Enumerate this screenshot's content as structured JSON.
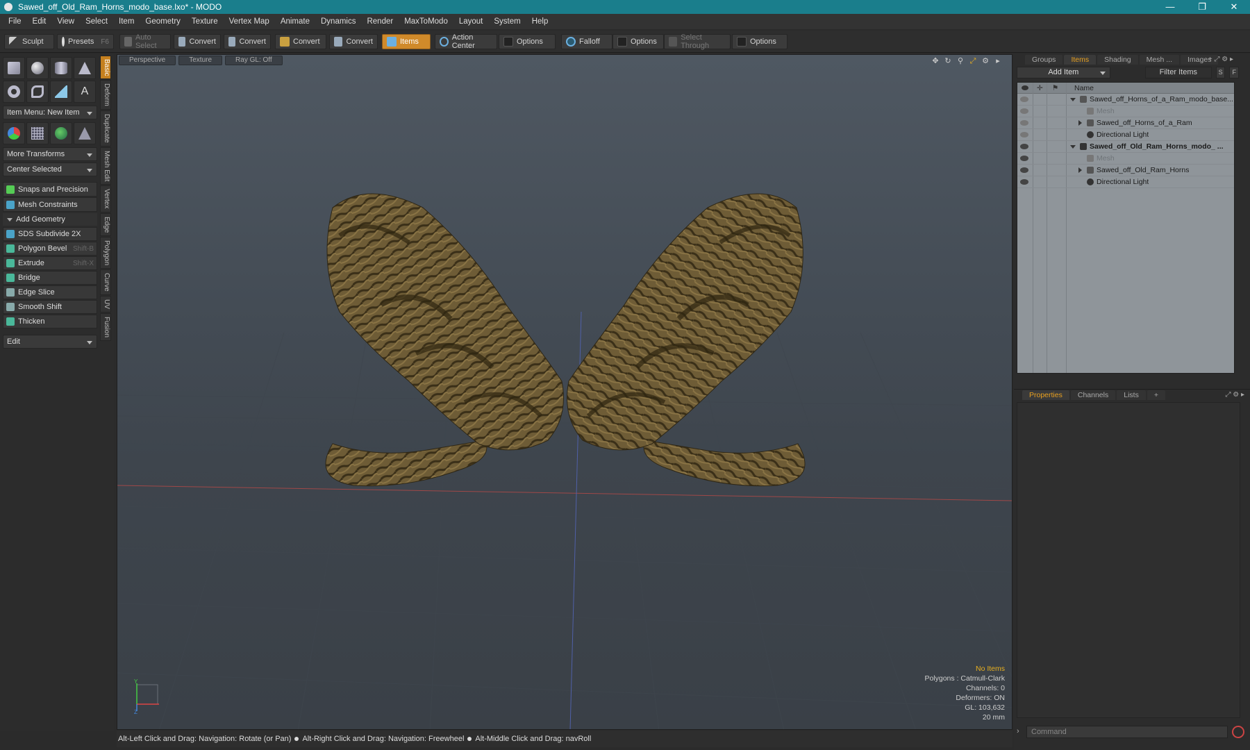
{
  "window": {
    "title": "Sawed_off_Old_Ram_Horns_modo_base.lxo* - MODO",
    "minimize": "—",
    "maximize": "❐",
    "close": "✕"
  },
  "menu": [
    "File",
    "Edit",
    "View",
    "Select",
    "Item",
    "Geometry",
    "Texture",
    "Vertex Map",
    "Animate",
    "Dynamics",
    "Render",
    "MaxToModo",
    "Layout",
    "System",
    "Help"
  ],
  "toolbar": {
    "sculpt": "Sculpt",
    "presets": "Presets",
    "presets_key": "F6",
    "auto_select": "Auto Select",
    "convert1": "Convert",
    "convert2": "Convert",
    "convert3": "Convert",
    "convert4": "Convert",
    "items": "Items",
    "action_center": "Action Center",
    "options1": "Options",
    "falloff": "Falloff",
    "options2": "Options",
    "select_through": "Select Through",
    "options3": "Options"
  },
  "left": {
    "item_menu": "Item Menu: New Item",
    "more_transforms": "More Transforms",
    "center_selected": "Center Selected",
    "snaps": "Snaps and Precision",
    "mesh_constraints": "Mesh Constraints",
    "add_geometry": "Add Geometry",
    "tools": [
      {
        "label": "SDS Subdivide 2X",
        "shortcut": ""
      },
      {
        "label": "Polygon Bevel",
        "shortcut": "Shift-B"
      },
      {
        "label": "Extrude",
        "shortcut": "Shift-X"
      },
      {
        "label": "Bridge",
        "shortcut": ""
      },
      {
        "label": "Edge Slice",
        "shortcut": ""
      },
      {
        "label": "Smooth Shift",
        "shortcut": ""
      },
      {
        "label": "Thicken",
        "shortcut": ""
      }
    ],
    "edit": "Edit",
    "vtabs": [
      "Basic",
      "Deform",
      "Duplicate",
      "Mesh Edit",
      "Vertex",
      "Edge",
      "Polygon",
      "Curve",
      "UV",
      "Fusion"
    ]
  },
  "viewport": {
    "tabs": [
      "Perspective",
      "Texture",
      "Ray GL: Off"
    ],
    "stats": {
      "selection": "No Items",
      "polygons": "Polygons : Catmull-Clark",
      "channels": "Channels: 0",
      "deformers": "Deformers: ON",
      "gl": "GL: 103,632",
      "unit": "20 mm"
    },
    "axis": {
      "y": "Y",
      "z": "Z"
    }
  },
  "status": {
    "hint1": "Alt-Left Click and Drag: Navigation: Rotate (or Pan)",
    "hint2": "Alt-Right Click and Drag: Navigation: Freewheel",
    "hint3": "Alt-Middle Click and Drag: navRoll"
  },
  "right": {
    "top_tabs": [
      "Groups",
      "Items",
      "Shading",
      "Mesh ...",
      "Images"
    ],
    "add_item": "Add Item",
    "filter_items": "Filter Items",
    "s_btn": "S",
    "f_btn": "F",
    "name_header": "Name",
    "items": [
      {
        "label": "Sawed_off_Horns_of_a_Ram_modo_base....",
        "style": "normal"
      },
      {
        "label": "Mesh",
        "style": "grey"
      },
      {
        "label": "Sawed_off_Horns_of_a_Ram",
        "style": "normal"
      },
      {
        "label": "Directional Light",
        "style": "normal"
      },
      {
        "label": "Sawed_off_Old_Ram_Horns_modo_ ...",
        "style": "bold"
      },
      {
        "label": "Mesh",
        "style": "grey"
      },
      {
        "label": "Sawed_off_Old_Ram_Horns",
        "style": "normal"
      },
      {
        "label": "Directional Light",
        "style": "normal"
      }
    ],
    "bottom_tabs": [
      "Properties",
      "Channels",
      "Lists"
    ],
    "command_placeholder": "Command"
  },
  "colors": {
    "accent": "#e8a020",
    "titlebar": "#1a7e8c",
    "horn": "#6b5a35"
  }
}
